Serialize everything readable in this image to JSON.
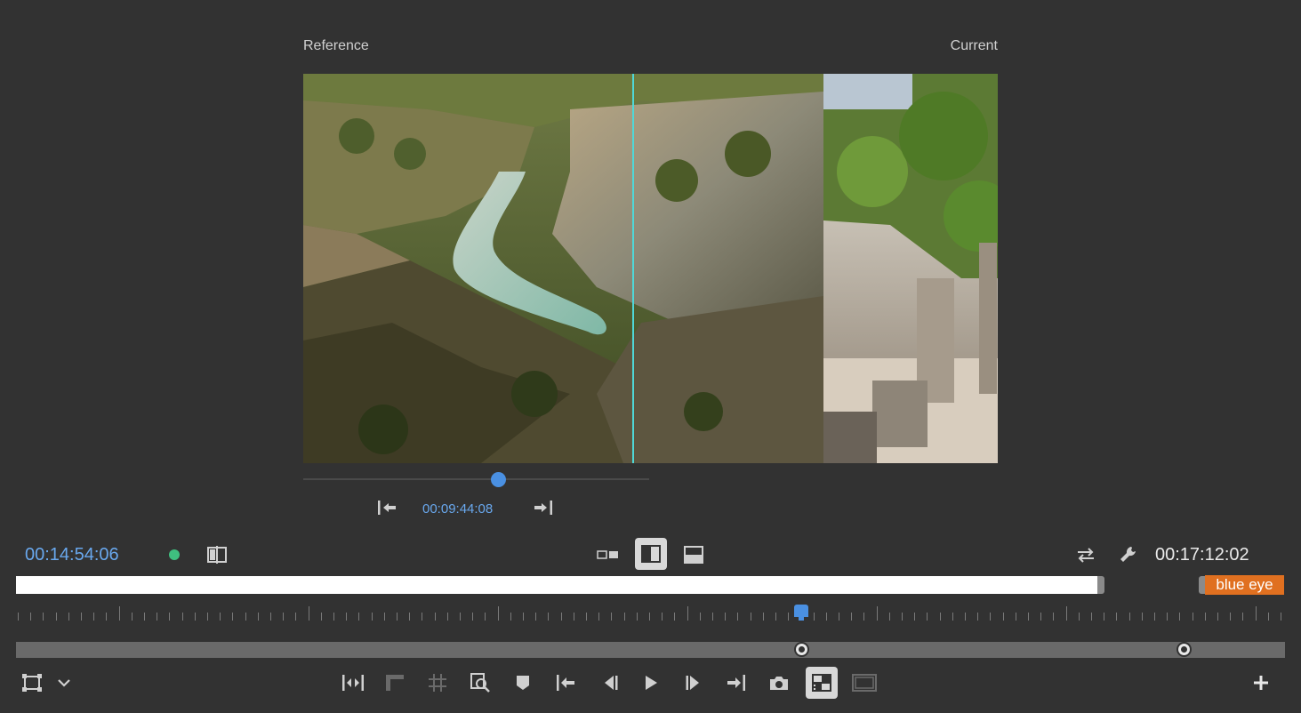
{
  "monitor": {
    "reference_label": "Reference",
    "current_label": "Current",
    "reference_timecode": "00:09:44:08",
    "reference_slider_position": 0.56
  },
  "controls": {
    "playhead_timecode": "00:14:54:06",
    "duration_timecode": "00:17:12:02",
    "marker_label": "blue eye",
    "playhead_position": 0.617,
    "in_handle_position": 0.617,
    "out_handle_position": 0.918
  },
  "colors": {
    "accent_blue": "#69a8ee",
    "status_green": "#3fbf7f",
    "marker_orange": "#e07020",
    "split_line": "#4fd8d8"
  },
  "icons": {
    "compare_view": "compare-view-icon",
    "side_by_side": "side-by-side-icon",
    "vertical_split": "vertical-split-icon",
    "horizontal_split": "horizontal-split-icon",
    "swap": "swap-icon",
    "wrench": "wrench-icon",
    "safe_margins": "safe-margins-icon",
    "chevron": "chevron-down-icon",
    "trim": "trim-icon",
    "ruler": "ruler-icon",
    "grid": "grid-icon",
    "zoom": "zoom-icon",
    "marker": "marker-icon",
    "go_to_in": "go-to-in-icon",
    "step_back": "step-back-icon",
    "play": "play-icon",
    "step_forward": "step-forward-icon",
    "go_to_out": "go-to-out-icon",
    "camera": "camera-icon",
    "comparison_view": "comparison-view-icon",
    "multi_camera": "multi-camera-icon",
    "add": "add-icon"
  }
}
